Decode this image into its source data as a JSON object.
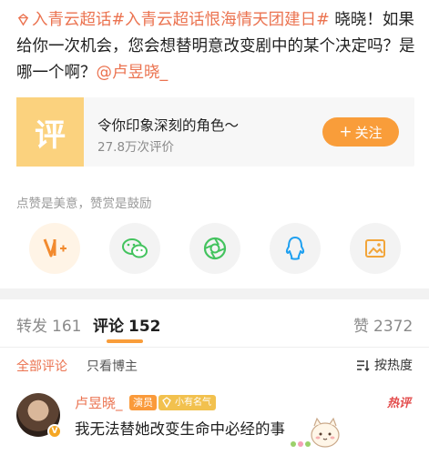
{
  "post": {
    "topic1": "入青云超话",
    "topic2": "#入青云超话恨海情天团建日#",
    "body": " 晓晓！如果给你一次机会，您会想替明意改变剧中的某个决定吗？是哪一个啊？",
    "mention": "@卢昱晓_"
  },
  "card": {
    "thumb_char": "评",
    "title": "令你印象深刻的角色～",
    "subtitle": "27.8万次评价",
    "follow_label": "关注",
    "follow_plus": "+"
  },
  "like_hint": "点赞是美意，赞赏是鼓励",
  "share_icons": [
    "reward-icon",
    "wechat-icon",
    "moments-icon",
    "qq-icon",
    "save-image-icon"
  ],
  "tabs": [
    {
      "label": "转发",
      "count": "161"
    },
    {
      "label": "评论",
      "count": "152"
    },
    {
      "label": "赞",
      "count": "2372"
    }
  ],
  "filters": {
    "all": "全部评论",
    "author_only": "只看博主",
    "sort": "按热度"
  },
  "comment": {
    "avatar_badge": "V",
    "name": "卢昱晓_",
    "badge_actor": "演员",
    "badge_fame": "小有名气",
    "hot_tag": "热评",
    "text": "我无法替她改变生命中必经的事"
  },
  "colors": {
    "accent": "#eb7350",
    "follow_button": "#f99d3a",
    "card_thumb": "#fbd27e"
  }
}
